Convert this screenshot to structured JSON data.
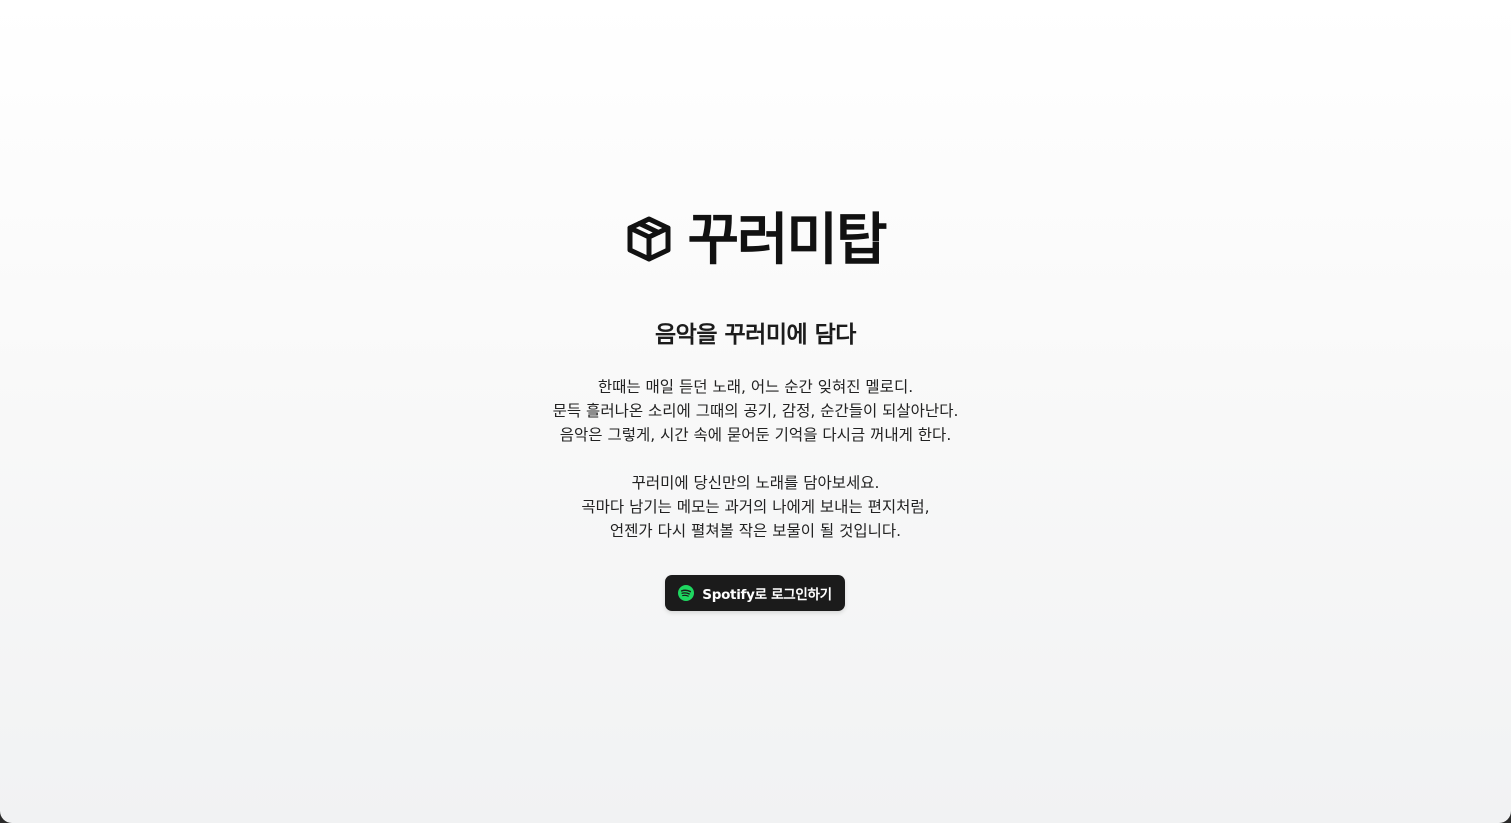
{
  "app": {
    "name": "꾸러미탑",
    "logo_icon": "package-box-icon"
  },
  "hero": {
    "tagline": "음악을 꾸러미에 담다",
    "paragraph1": [
      "한때는 매일 듣던 노래, 어느 순간 잊혀진 멜로디.",
      "문득 흘러나온 소리에 그때의 공기, 감정, 순간들이 되살아난다.",
      "음악은 그렇게, 시간 속에 묻어둔 기억을 다시금 꺼내게 한다."
    ],
    "paragraph2": [
      "꾸러미에 당신만의 노래를 담아보세요.",
      "곡마다 남기는 메모는 과거의 나에게 보내는 편지처럼,",
      "언젠가 다시 펼쳐볼 작은 보물이 될 것입니다."
    ]
  },
  "login": {
    "label": "Spotify로 로그인하기",
    "icon": "spotify-icon"
  },
  "colors": {
    "button_bg": "#1b1b1b",
    "spotify_green": "#1ed760",
    "text": "#1a1a1a"
  }
}
